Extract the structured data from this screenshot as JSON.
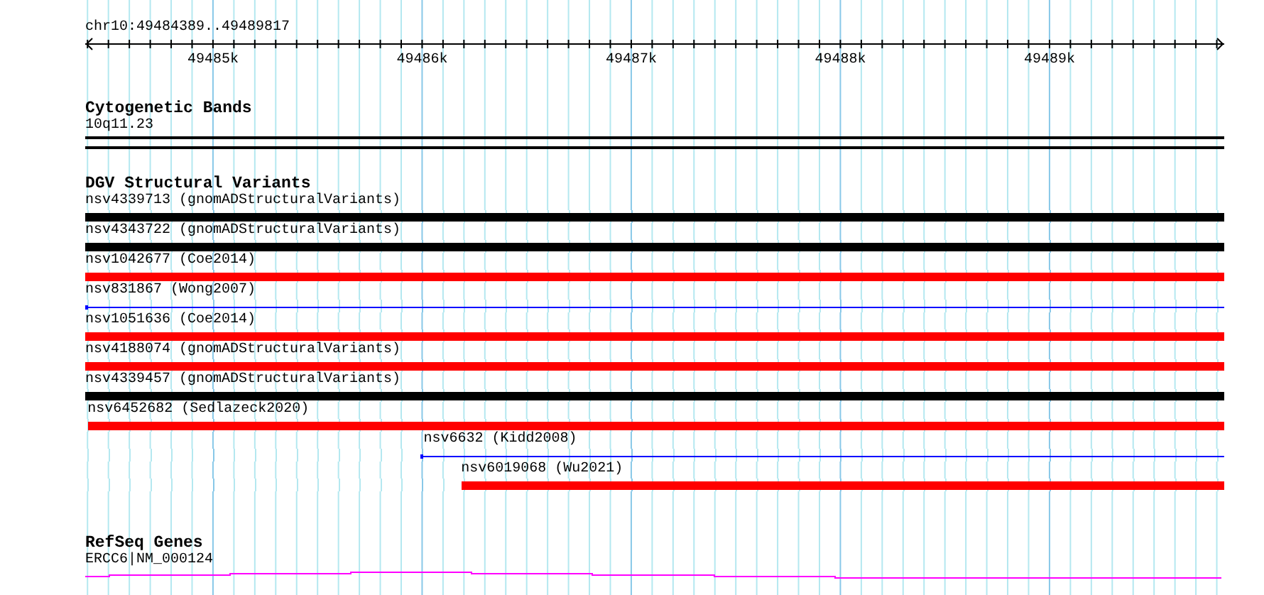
{
  "ruler": {
    "location": "chr10:49484389..49489817",
    "ticks": [
      "49485k",
      "49486k",
      "49487k",
      "49488k",
      "49489k"
    ]
  },
  "cytogenetic_bands": {
    "title": "Cytogenetic Bands",
    "band": "10q11.23"
  },
  "dgv_structural_variants": {
    "title": "DGV Structural Variants",
    "features": [
      {
        "label": "nsv4339713 (gnomADStructuralVariants)",
        "kind": "thick",
        "color": "#000000",
        "level": 1
      },
      {
        "label": "nsv4343722 (gnomADStructuralVariants)",
        "kind": "thick",
        "color": "#000000",
        "level": 1
      },
      {
        "label": "nsv1042677 (Coe2014)",
        "kind": "thick",
        "color": "#ff0000",
        "level": 1
      },
      {
        "label": "nsv831867 (Wong2007)",
        "kind": "thin",
        "color": "#0000ff",
        "level": 1
      },
      {
        "label": "nsv1051636 (Coe2014)",
        "kind": "thick",
        "color": "#ff0000",
        "level": 1
      },
      {
        "label": "nsv4188074 (gnomADStructuralVariants)",
        "kind": "thick",
        "color": "#ff0000",
        "level": 1
      },
      {
        "label": "nsv4339457 (gnomADStructuralVariants)",
        "kind": "thick",
        "color": "#000000",
        "level": 1
      },
      {
        "label": "nsv6452682 (Sedlazeck2020)",
        "kind": "thick",
        "color": "#ff0000",
        "level": 0.998
      },
      {
        "label": "nsv6632 (Kidd2008)",
        "kind": "thin",
        "color": "#0000ff",
        "level": 0.703
      },
      {
        "label": "nsv6019068 (Wu2021)",
        "kind": "thick",
        "color": "#ff0000",
        "level": 0.67
      }
    ]
  },
  "refseq_genes": {
    "title": "RefSeq Genes",
    "gene": "ERCC6|NM_000124"
  }
}
